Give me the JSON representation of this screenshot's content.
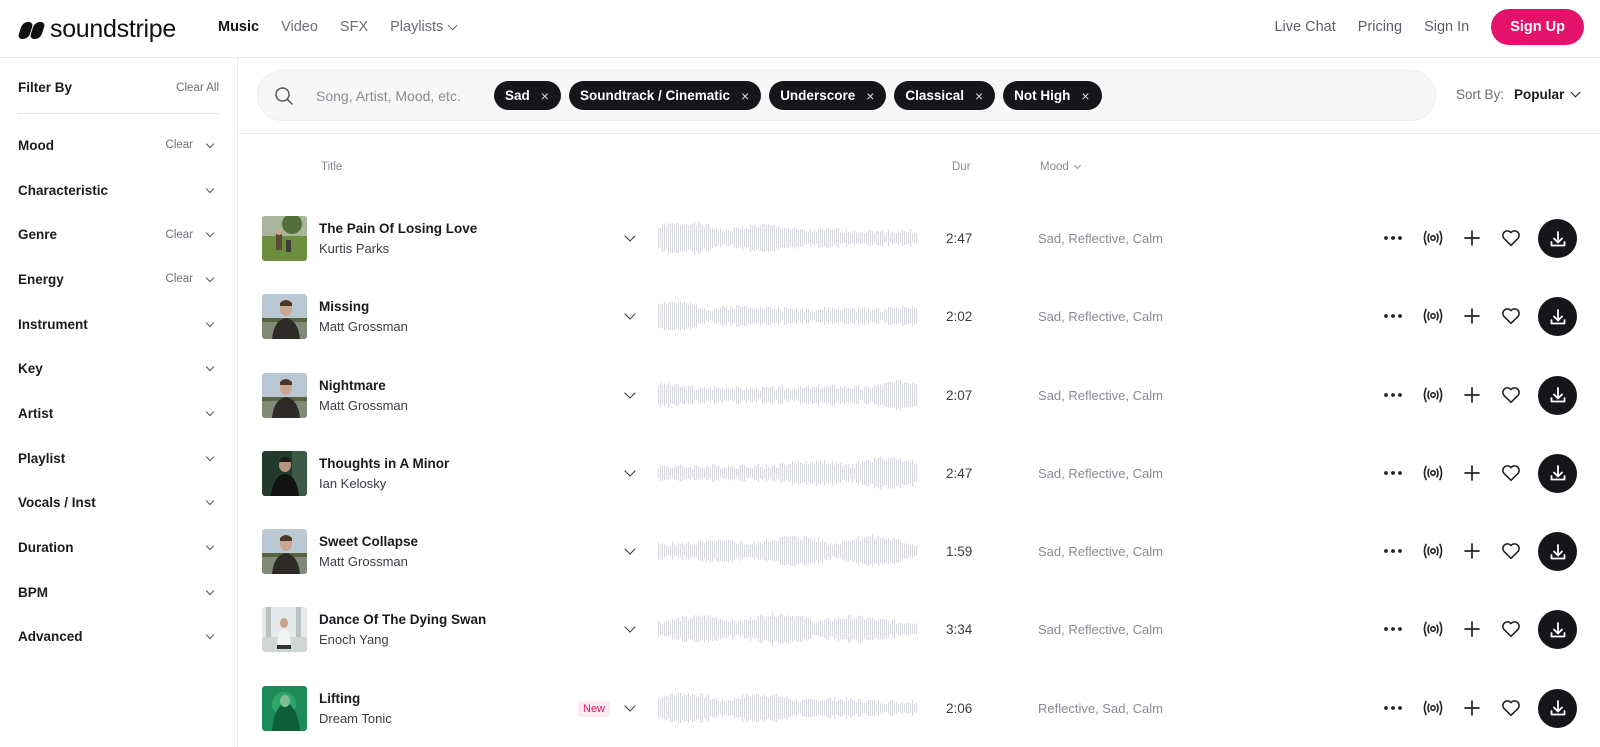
{
  "brand": {
    "name": "soundstripe"
  },
  "nav": {
    "items": [
      {
        "label": "Music",
        "active": true
      },
      {
        "label": "Video",
        "active": false
      },
      {
        "label": "SFX",
        "active": false
      },
      {
        "label": "Playlists",
        "active": false,
        "dropdown": true
      }
    ],
    "right": {
      "live_chat": "Live Chat",
      "pricing": "Pricing",
      "sign_in": "Sign In",
      "sign_up": "Sign Up"
    }
  },
  "colors": {
    "accent": "#e4126b",
    "dark": "#15151a",
    "muted": "#8a8a92"
  },
  "sidebar": {
    "title": "Filter By",
    "clear_all": "Clear All",
    "filters": [
      {
        "label": "Mood",
        "clear": "Clear"
      },
      {
        "label": "Characteristic",
        "clear": ""
      },
      {
        "label": "Genre",
        "clear": "Clear"
      },
      {
        "label": "Energy",
        "clear": "Clear"
      },
      {
        "label": "Instrument",
        "clear": ""
      },
      {
        "label": "Key",
        "clear": ""
      },
      {
        "label": "Artist",
        "clear": ""
      },
      {
        "label": "Playlist",
        "clear": ""
      },
      {
        "label": "Vocals / Inst",
        "clear": ""
      },
      {
        "label": "Duration",
        "clear": ""
      },
      {
        "label": "BPM",
        "clear": ""
      },
      {
        "label": "Advanced",
        "clear": ""
      }
    ]
  },
  "search": {
    "placeholder": "Song, Artist, Mood, etc.",
    "value": "",
    "chips": [
      "Sad",
      "Soundtrack / Cinematic",
      "Underscore",
      "Classical",
      "Not High"
    ]
  },
  "sort": {
    "label": "Sort By:",
    "value": "Popular"
  },
  "table": {
    "headers": {
      "title": "Title",
      "duration": "Dur",
      "mood": "Mood"
    },
    "tracks": [
      {
        "title": "The Pain Of Losing Love",
        "artist": "Kurtis Parks",
        "duration": "2:47",
        "moods": "Sad, Reflective, Calm",
        "badge": "",
        "art": "field"
      },
      {
        "title": "Missing",
        "artist": "Matt Grossman",
        "duration": "2:02",
        "moods": "Sad, Reflective, Calm",
        "badge": "",
        "art": "portrait-lake"
      },
      {
        "title": "Nightmare",
        "artist": "Matt Grossman",
        "duration": "2:07",
        "moods": "Sad, Reflective, Calm",
        "badge": "",
        "art": "portrait-lake"
      },
      {
        "title": "Thoughts in A Minor",
        "artist": "Ian Kelosky",
        "duration": "2:47",
        "moods": "Sad, Reflective, Calm",
        "badge": "",
        "art": "portrait-dark"
      },
      {
        "title": "Sweet Collapse",
        "artist": "Matt Grossman",
        "duration": "1:59",
        "moods": "Sad, Reflective, Calm",
        "badge": "",
        "art": "portrait-lake"
      },
      {
        "title": "Dance Of The Dying Swan",
        "artist": "Enoch Yang",
        "duration": "3:34",
        "moods": "Sad, Reflective, Calm",
        "badge": "",
        "art": "portrait-bright"
      },
      {
        "title": "Lifting",
        "artist": "Dream Tonic",
        "duration": "2:06",
        "moods": "Reflective, Sad, Calm",
        "badge": "New",
        "art": "green"
      }
    ]
  }
}
